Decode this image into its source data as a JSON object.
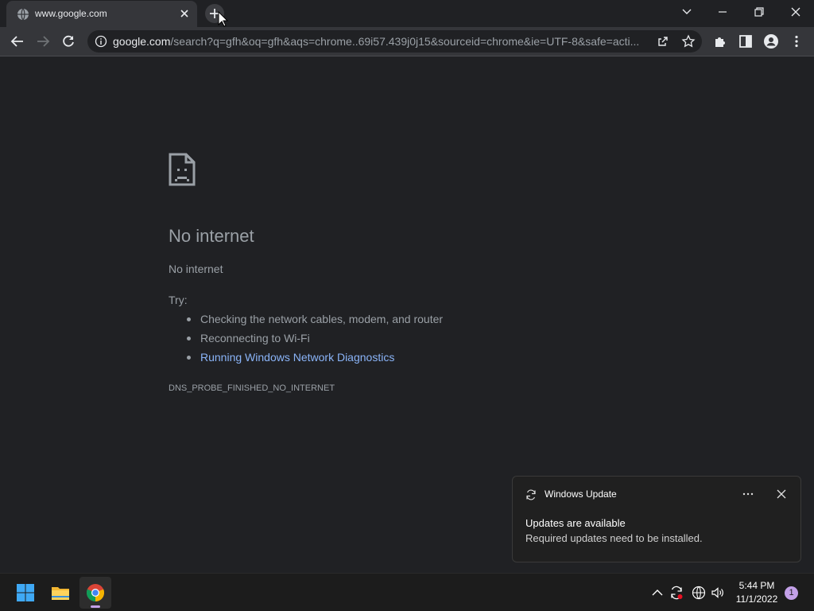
{
  "tab": {
    "title": "www.google.com",
    "icons": {
      "favicon": "globe-icon",
      "close": "close-icon"
    }
  },
  "tabstrip": {
    "new_tab_icon": "plus-icon",
    "window_controls": [
      "chevron-down-icon",
      "minimize-icon",
      "restore-icon",
      "close-icon"
    ]
  },
  "toolbar": {
    "url_host": "google.com",
    "url_rest": "/search?q=gfh&oq=gfh&aqs=chrome..69i57.439j0j15&sourceid=chrome&ie=UTF-8&safe=acti...",
    "icons": [
      "back-icon",
      "forward-icon",
      "reload-icon",
      "info-icon",
      "share-icon",
      "star-icon",
      "extensions-icon",
      "side-panel-icon",
      "profile-icon",
      "menu-icon"
    ]
  },
  "error_page": {
    "title": "No internet",
    "subtitle": "No internet",
    "try_label": "Try:",
    "suggestions": [
      "Checking the network cables, modem, and router",
      "Reconnecting to Wi-Fi",
      "Running Windows Network Diagnostics"
    ],
    "error_code": "DNS_PROBE_FINISHED_NO_INTERNET",
    "link_color": "#8ab4f8"
  },
  "toast": {
    "app_name": "Windows Update",
    "title": "Updates are available",
    "body": "Required updates need to be installed."
  },
  "taskbar": {
    "apps": [
      "windows-start-icon",
      "file-explorer-icon",
      "chrome-icon"
    ],
    "tray_icons": [
      "chevron-up-icon",
      "sync-update-icon",
      "network-globe-icon",
      "volume-icon"
    ],
    "time": "5:44 PM",
    "date": "11/1/2022",
    "notification_count": "1",
    "accent_color": "#c3a0e8"
  }
}
